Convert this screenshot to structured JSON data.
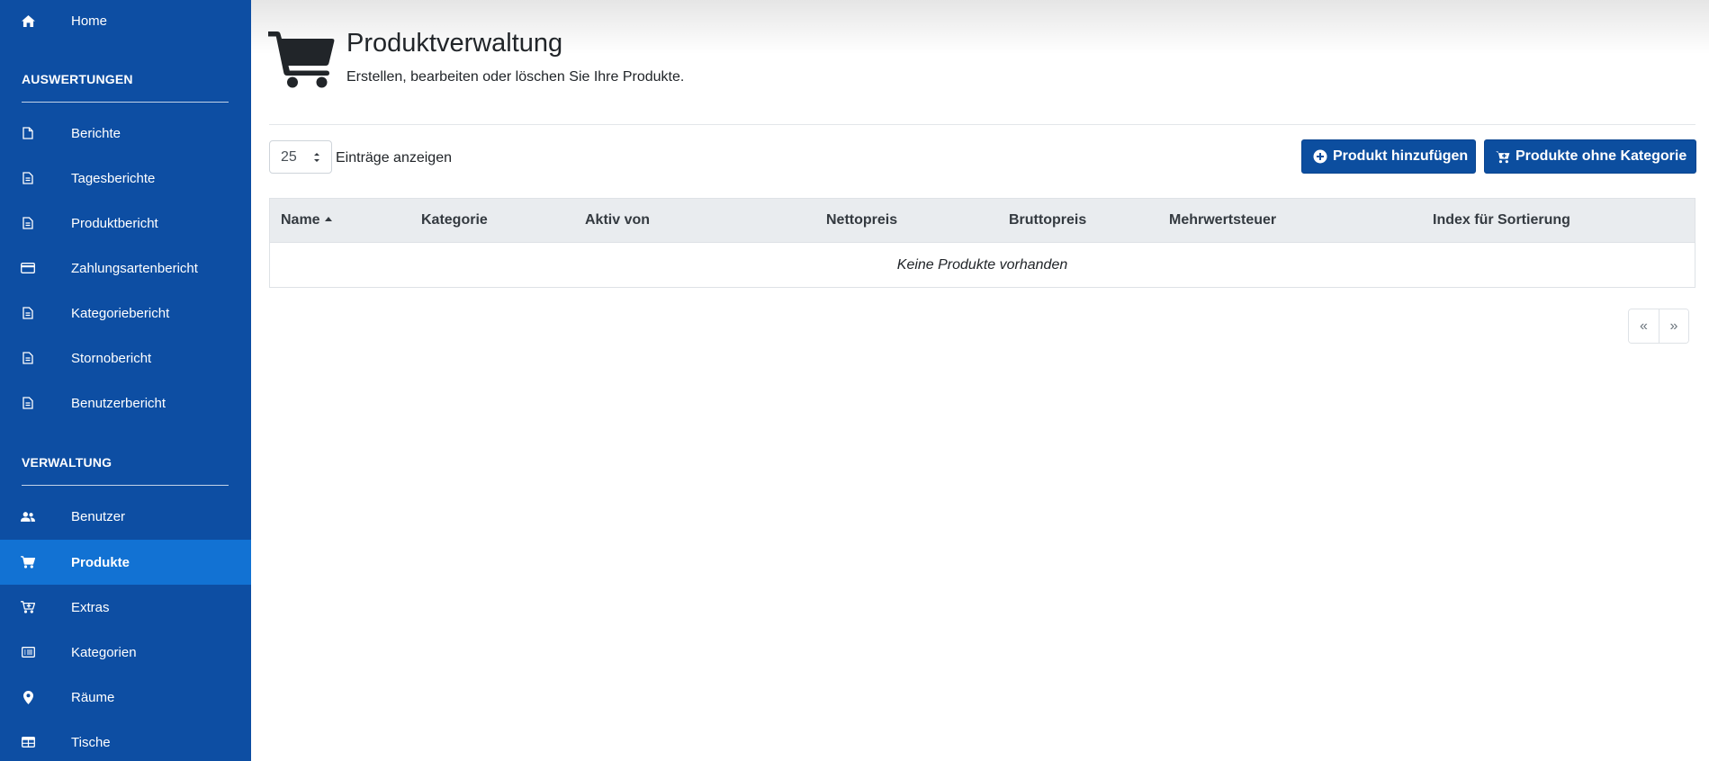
{
  "sidebar": {
    "home": {
      "label": "Home",
      "icon": "home-icon"
    },
    "sections": [
      {
        "title": "AUSWERTUNGEN",
        "items": [
          {
            "label": "Berichte",
            "icon": "file-icon"
          },
          {
            "label": "Tagesberichte",
            "icon": "file-text-icon"
          },
          {
            "label": "Produktbericht",
            "icon": "file-text-icon"
          },
          {
            "label": "Zahlungsartenbericht",
            "icon": "credit-card-icon"
          },
          {
            "label": "Kategoriebericht",
            "icon": "file-text-icon"
          },
          {
            "label": "Stornobericht",
            "icon": "file-text-icon"
          },
          {
            "label": "Benutzerbericht",
            "icon": "file-text-icon"
          }
        ]
      },
      {
        "title": "VERWALTUNG",
        "items": [
          {
            "label": "Benutzer",
            "icon": "users-icon"
          },
          {
            "label": "Produkte",
            "icon": "shopping-cart-icon",
            "active": true
          },
          {
            "label": "Extras",
            "icon": "cart-plus-icon"
          },
          {
            "label": "Kategorien",
            "icon": "list-icon"
          },
          {
            "label": "Räume",
            "icon": "map-marker-icon"
          },
          {
            "label": "Tische",
            "icon": "table-icon"
          }
        ]
      }
    ]
  },
  "header": {
    "icon": "shopping-cart-icon",
    "title": "Produktverwaltung",
    "subtitle": "Erstellen, bearbeiten oder löschen Sie Ihre Produkte."
  },
  "controls": {
    "page_length": "25",
    "page_length_label": "Einträge anzeigen",
    "add_product_label": "Produkt hinzufügen",
    "products_without_category_label": "Produkte ohne Kategorie"
  },
  "table": {
    "columns": [
      "Name",
      "Kategorie",
      "Aktiv von",
      "Nettopreis",
      "Bruttopreis",
      "Mehrwertsteuer",
      "Index für Sortierung"
    ],
    "sorted_column": "Name",
    "empty_message": "Keine Produkte vorhanden"
  },
  "pagination": {
    "prev": "«",
    "next": "»"
  },
  "colors": {
    "sidebar_bg": "#0d4ea3",
    "sidebar_active": "#1272d3",
    "button_bg": "#0c4e9f"
  }
}
